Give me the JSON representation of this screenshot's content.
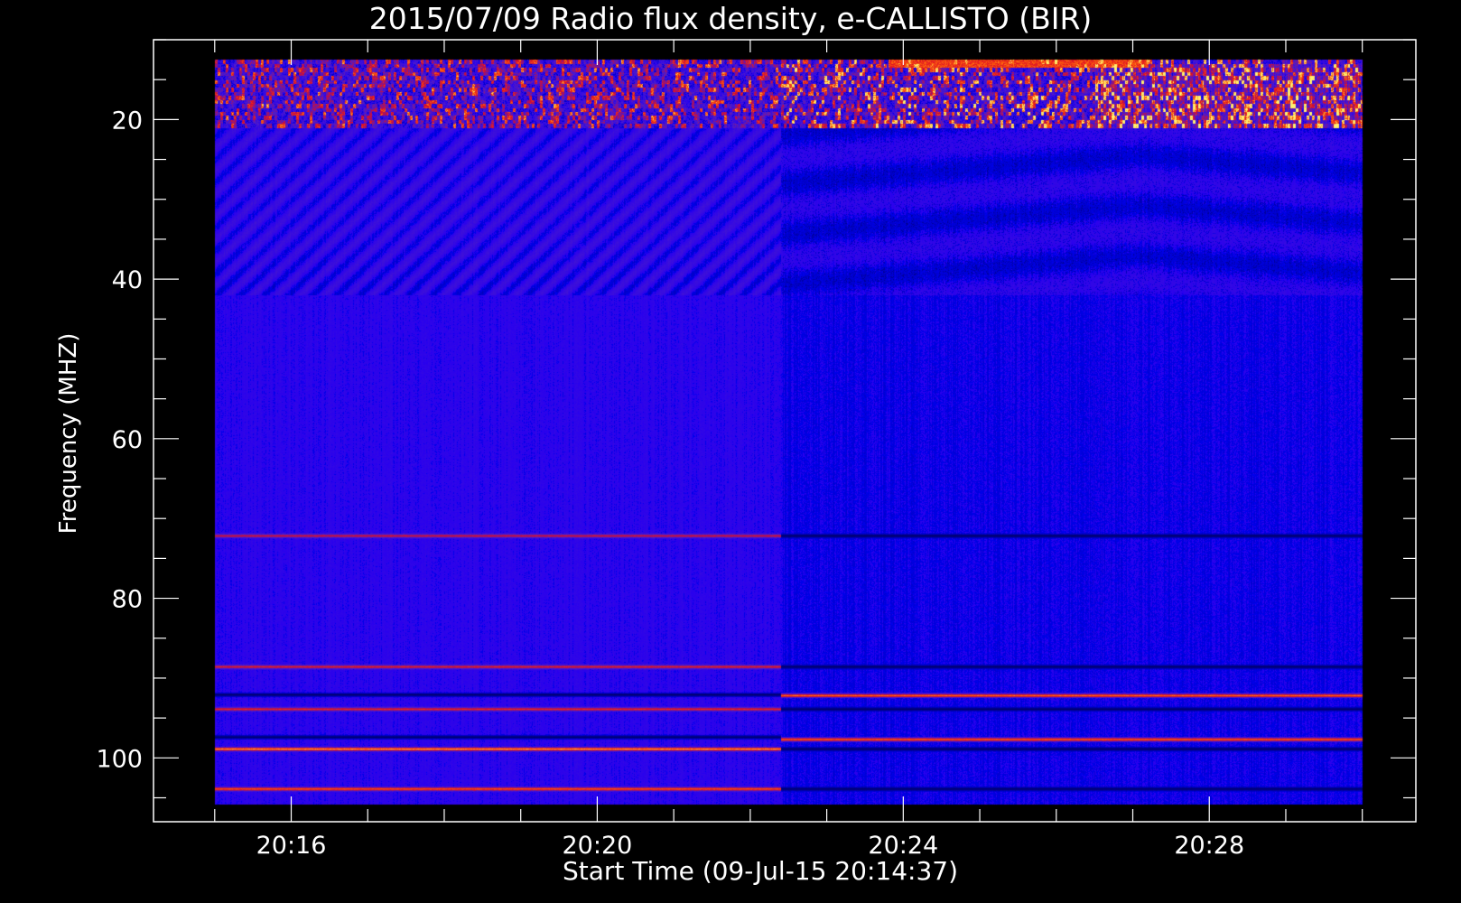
{
  "colors": {
    "background": "#000000",
    "foreground": "#ffffff",
    "spectrogram_base": "#2020f0",
    "spectrogram_hot": "#ff3010",
    "spectrogram_max": "#ffe070"
  },
  "chart_data": {
    "type": "heatmap",
    "title": "2015/07/09  Radio flux density, e-CALLISTO (BIR)",
    "xlabel": "Start Time (09-Jul-15 20:14:37)",
    "ylabel": "Frequency (MHZ)",
    "y_axis": {
      "range": [
        10,
        108
      ],
      "inverted": true,
      "major_ticks": [
        20,
        40,
        60,
        80,
        100
      ],
      "tick_labels": [
        "20",
        "40",
        "60",
        "80",
        "100"
      ],
      "minor_step": 5
    },
    "x_axis": {
      "range_min": [
        14.2,
        30.7
      ],
      "major_ticks_min": [
        16,
        20,
        24,
        28
      ],
      "tick_labels": [
        "20:16",
        "20:20",
        "20:24",
        "20:28"
      ],
      "minor_step_min": 1
    },
    "data_extent": {
      "time_min": [
        15,
        30
      ],
      "freq_mhz": [
        12.5,
        105.8
      ]
    },
    "segment_change_min": 22.4,
    "rfi_bands": [
      {
        "segment": 1,
        "freq": 88.5,
        "intensity": 0.55
      },
      {
        "segment": 1,
        "freq": 92,
        "intensity": 0.0
      },
      {
        "segment": 1,
        "freq": 93.8,
        "intensity": 0.6
      },
      {
        "segment": 1,
        "freq": 97.3,
        "intensity": 0.0
      },
      {
        "segment": 1,
        "freq": 98.8,
        "intensity": 1.0
      },
      {
        "segment": 1,
        "freq": 103.8,
        "intensity": 0.85
      },
      {
        "segment": 1,
        "freq": 72.1,
        "intensity": 0.45
      },
      {
        "segment": 2,
        "freq": 88.5,
        "intensity": 0.0
      },
      {
        "segment": 2,
        "freq": 92.1,
        "intensity": 0.9
      },
      {
        "segment": 2,
        "freq": 93.8,
        "intensity": 0.0
      },
      {
        "segment": 2,
        "freq": 97.6,
        "intensity": 0.9
      },
      {
        "segment": 2,
        "freq": 98.8,
        "intensity": 0.0
      },
      {
        "segment": 2,
        "freq": 103.8,
        "intensity": 0.0
      },
      {
        "segment": 2,
        "freq": 72.1,
        "intensity": 0.0
      }
    ]
  }
}
